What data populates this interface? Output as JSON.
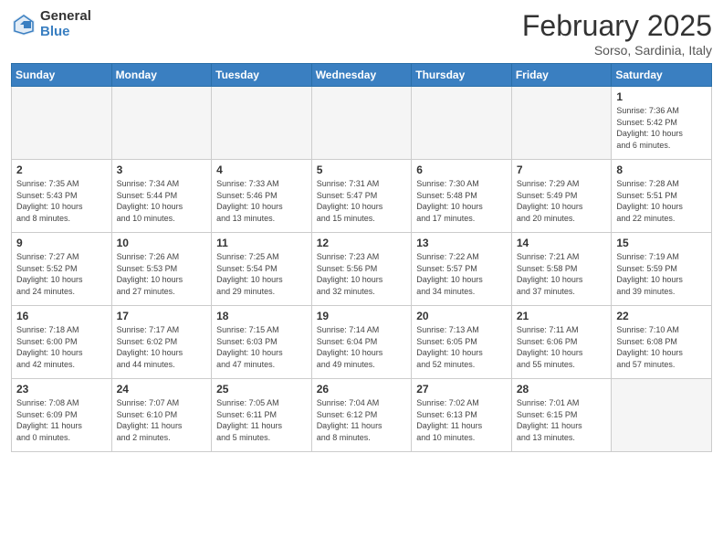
{
  "header": {
    "logo_general": "General",
    "logo_blue": "Blue",
    "month_title": "February 2025",
    "location": "Sorso, Sardinia, Italy"
  },
  "days_of_week": [
    "Sunday",
    "Monday",
    "Tuesday",
    "Wednesday",
    "Thursday",
    "Friday",
    "Saturday"
  ],
  "weeks": [
    [
      {
        "day": "",
        "info": ""
      },
      {
        "day": "",
        "info": ""
      },
      {
        "day": "",
        "info": ""
      },
      {
        "day": "",
        "info": ""
      },
      {
        "day": "",
        "info": ""
      },
      {
        "day": "",
        "info": ""
      },
      {
        "day": "1",
        "info": "Sunrise: 7:36 AM\nSunset: 5:42 PM\nDaylight: 10 hours\nand 6 minutes."
      }
    ],
    [
      {
        "day": "2",
        "info": "Sunrise: 7:35 AM\nSunset: 5:43 PM\nDaylight: 10 hours\nand 8 minutes."
      },
      {
        "day": "3",
        "info": "Sunrise: 7:34 AM\nSunset: 5:44 PM\nDaylight: 10 hours\nand 10 minutes."
      },
      {
        "day": "4",
        "info": "Sunrise: 7:33 AM\nSunset: 5:46 PM\nDaylight: 10 hours\nand 13 minutes."
      },
      {
        "day": "5",
        "info": "Sunrise: 7:31 AM\nSunset: 5:47 PM\nDaylight: 10 hours\nand 15 minutes."
      },
      {
        "day": "6",
        "info": "Sunrise: 7:30 AM\nSunset: 5:48 PM\nDaylight: 10 hours\nand 17 minutes."
      },
      {
        "day": "7",
        "info": "Sunrise: 7:29 AM\nSunset: 5:49 PM\nDaylight: 10 hours\nand 20 minutes."
      },
      {
        "day": "8",
        "info": "Sunrise: 7:28 AM\nSunset: 5:51 PM\nDaylight: 10 hours\nand 22 minutes."
      }
    ],
    [
      {
        "day": "9",
        "info": "Sunrise: 7:27 AM\nSunset: 5:52 PM\nDaylight: 10 hours\nand 24 minutes."
      },
      {
        "day": "10",
        "info": "Sunrise: 7:26 AM\nSunset: 5:53 PM\nDaylight: 10 hours\nand 27 minutes."
      },
      {
        "day": "11",
        "info": "Sunrise: 7:25 AM\nSunset: 5:54 PM\nDaylight: 10 hours\nand 29 minutes."
      },
      {
        "day": "12",
        "info": "Sunrise: 7:23 AM\nSunset: 5:56 PM\nDaylight: 10 hours\nand 32 minutes."
      },
      {
        "day": "13",
        "info": "Sunrise: 7:22 AM\nSunset: 5:57 PM\nDaylight: 10 hours\nand 34 minutes."
      },
      {
        "day": "14",
        "info": "Sunrise: 7:21 AM\nSunset: 5:58 PM\nDaylight: 10 hours\nand 37 minutes."
      },
      {
        "day": "15",
        "info": "Sunrise: 7:19 AM\nSunset: 5:59 PM\nDaylight: 10 hours\nand 39 minutes."
      }
    ],
    [
      {
        "day": "16",
        "info": "Sunrise: 7:18 AM\nSunset: 6:00 PM\nDaylight: 10 hours\nand 42 minutes."
      },
      {
        "day": "17",
        "info": "Sunrise: 7:17 AM\nSunset: 6:02 PM\nDaylight: 10 hours\nand 44 minutes."
      },
      {
        "day": "18",
        "info": "Sunrise: 7:15 AM\nSunset: 6:03 PM\nDaylight: 10 hours\nand 47 minutes."
      },
      {
        "day": "19",
        "info": "Sunrise: 7:14 AM\nSunset: 6:04 PM\nDaylight: 10 hours\nand 49 minutes."
      },
      {
        "day": "20",
        "info": "Sunrise: 7:13 AM\nSunset: 6:05 PM\nDaylight: 10 hours\nand 52 minutes."
      },
      {
        "day": "21",
        "info": "Sunrise: 7:11 AM\nSunset: 6:06 PM\nDaylight: 10 hours\nand 55 minutes."
      },
      {
        "day": "22",
        "info": "Sunrise: 7:10 AM\nSunset: 6:08 PM\nDaylight: 10 hours\nand 57 minutes."
      }
    ],
    [
      {
        "day": "23",
        "info": "Sunrise: 7:08 AM\nSunset: 6:09 PM\nDaylight: 11 hours\nand 0 minutes."
      },
      {
        "day": "24",
        "info": "Sunrise: 7:07 AM\nSunset: 6:10 PM\nDaylight: 11 hours\nand 2 minutes."
      },
      {
        "day": "25",
        "info": "Sunrise: 7:05 AM\nSunset: 6:11 PM\nDaylight: 11 hours\nand 5 minutes."
      },
      {
        "day": "26",
        "info": "Sunrise: 7:04 AM\nSunset: 6:12 PM\nDaylight: 11 hours\nand 8 minutes."
      },
      {
        "day": "27",
        "info": "Sunrise: 7:02 AM\nSunset: 6:13 PM\nDaylight: 11 hours\nand 10 minutes."
      },
      {
        "day": "28",
        "info": "Sunrise: 7:01 AM\nSunset: 6:15 PM\nDaylight: 11 hours\nand 13 minutes."
      },
      {
        "day": "",
        "info": ""
      }
    ]
  ]
}
